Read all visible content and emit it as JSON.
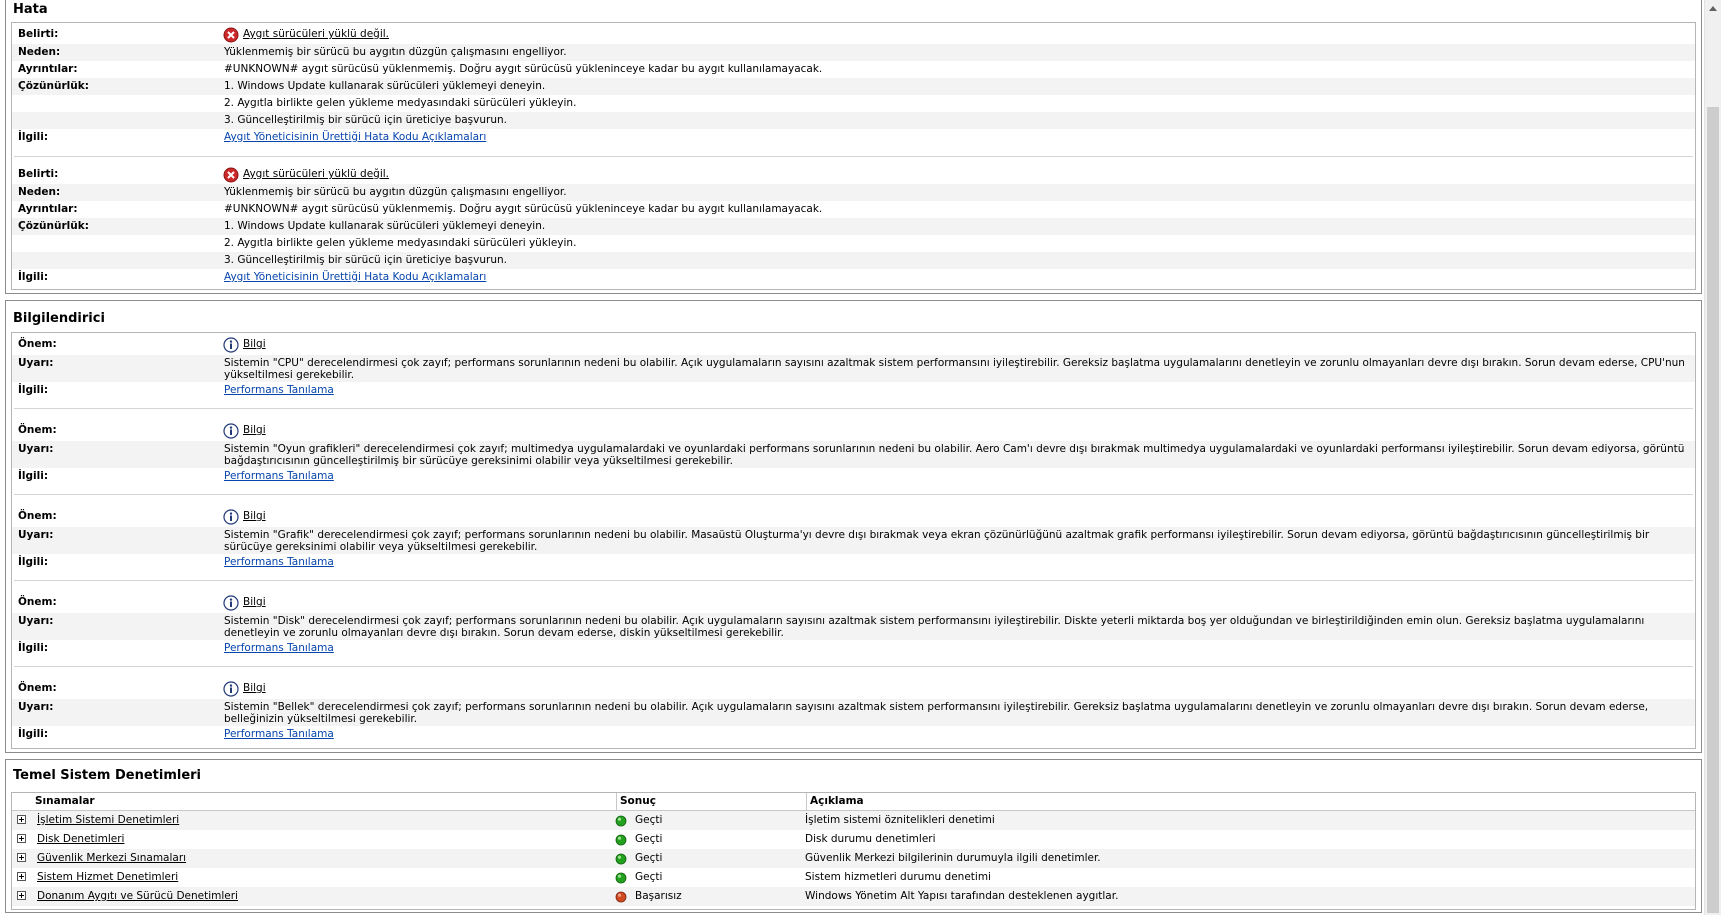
{
  "hata": {
    "title": "Hata",
    "entries": [
      {
        "belirti_label": "Belirti:",
        "belirti": "Aygıt sürücüleri yüklü değil.",
        "neden_label": "Neden:",
        "neden": "Yüklenmemiş bir sürücü bu aygıtın düzgün çalışmasını engelliyor.",
        "ayrintilar_label": "Ayrıntılar:",
        "ayrintilar": "#UNKNOWN# aygıt sürücüsü yüklenmemiş. Doğru aygıt sürücüsü yükleninceye kadar bu aygıt kullanılamayacak.",
        "cozunurluk_label": "Çözünürlük:",
        "cozunurluk": [
          "1. Windows Update kullanarak sürücüleri yüklemeyi deneyin.",
          "2. Aygıtla birlikte gelen yükleme medyasındaki sürücüleri yükleyin.",
          "3. Güncelleştirilmiş bir sürücü için üreticiye başvurun."
        ],
        "ilgili_label": "İlgili:",
        "ilgili": "Aygıt Yöneticisinin Ürettiği Hata Kodu Açıklamaları"
      },
      {
        "belirti_label": "Belirti:",
        "belirti": "Aygıt sürücüleri yüklü değil.",
        "neden_label": "Neden:",
        "neden": "Yüklenmemiş bir sürücü bu aygıtın düzgün çalışmasını engelliyor.",
        "ayrintilar_label": "Ayrıntılar:",
        "ayrintilar": "#UNKNOWN# aygıt sürücüsü yüklenmemiş. Doğru aygıt sürücüsü yükleninceye kadar bu aygıt kullanılamayacak.",
        "cozunurluk_label": "Çözünürlük:",
        "cozunurluk": [
          "1. Windows Update kullanarak sürücüleri yüklemeyi deneyin.",
          "2. Aygıtla birlikte gelen yükleme medyasındaki sürücüleri yükleyin.",
          "3. Güncelleştirilmiş bir sürücü için üreticiye başvurun."
        ],
        "ilgili_label": "İlgili:",
        "ilgili": "Aygıt Yöneticisinin Ürettiği Hata Kodu Açıklamaları"
      }
    ]
  },
  "bilgi": {
    "title": "Bilgilendirici",
    "entries": [
      {
        "onem_label": "Önem:",
        "onem": "Bilgi",
        "uyari_label": "Uyarı:",
        "uyari": "Sistemin \"CPU\" derecelendirmesi çok zayıf; performans sorunlarının nedeni bu olabilir. Açık uygulamaların sayısını azaltmak sistem performansını iyileştirebilir. Gereksiz başlatma uygulamalarını denetleyin ve zorunlu olmayanları devre dışı bırakın. Sorun devam ederse, CPU'nun yükseltilmesi gerekebilir.",
        "ilgili_label": "İlgili:",
        "ilgili": "Performans Tanılama"
      },
      {
        "onem_label": "Önem:",
        "onem": "Bilgi",
        "uyari_label": "Uyarı:",
        "uyari": "Sistemin \"Oyun grafikleri\" derecelendirmesi çok zayıf; multimedya uygulamalardaki ve oyunlardaki performans sorunlarının nedeni bu olabilir. Aero Cam'ı devre dışı bırakmak multimedya uygulamalardaki ve oyunlardaki performansı iyileştirebilir. Sorun devam ediyorsa, görüntü bağdaştırıcısının güncelleştirilmiş bir sürücüye gereksinimi olabilir veya yükseltilmesi gerekebilir.",
        "ilgili_label": "İlgili:",
        "ilgili": "Performans Tanılama"
      },
      {
        "onem_label": "Önem:",
        "onem": "Bilgi",
        "uyari_label": "Uyarı:",
        "uyari": "Sistemin \"Grafik\" derecelendirmesi çok zayıf; performans sorunlarının nedeni bu olabilir. Masaüstü Oluşturma'yı devre dışı bırakmak veya ekran çözünürlüğünü azaltmak grafik performansı iyileştirebilir. Sorun devam ediyorsa, görüntü bağdaştırıcısının güncelleştirilmiş bir sürücüye gereksinimi olabilir veya yükseltilmesi gerekebilir.",
        "ilgili_label": "İlgili:",
        "ilgili": "Performans Tanılama"
      },
      {
        "onem_label": "Önem:",
        "onem": "Bilgi",
        "uyari_label": "Uyarı:",
        "uyari": "Sistemin \"Disk\" derecelendirmesi çok zayıf; performans sorunlarının nedeni bu olabilir. Açık uygulamaların sayısını azaltmak sistem performansını iyileştirebilir. Diskte yeterli miktarda boş yer olduğundan ve birleştirildiğinden emin olun. Gereksiz başlatma uygulamalarını denetleyin ve zorunlu olmayanları devre dışı bırakın. Sorun devam ederse, diskin yükseltilmesi gerekebilir.",
        "ilgili_label": "İlgili:",
        "ilgili": "Performans Tanılama"
      },
      {
        "onem_label": "Önem:",
        "onem": "Bilgi",
        "uyari_label": "Uyarı:",
        "uyari": "Sistemin \"Bellek\" derecelendirmesi çok zayıf; performans sorunlarının nedeni bu olabilir. Açık uygulamaların sayısını azaltmak sistem performansını iyileştirebilir. Gereksiz başlatma uygulamalarını denetleyin ve zorunlu olmayanları devre dışı bırakın. Sorun devam ederse, belleğinizin yükseltilmesi gerekebilir.",
        "ilgili_label": "İlgili:",
        "ilgili": "Performans Tanılama"
      }
    ]
  },
  "temel": {
    "title": "Temel Sistem Denetimleri",
    "headers": [
      "Sınamalar",
      "Sonuç",
      "Açıklama"
    ],
    "rows": [
      {
        "name": "İşletim Sistemi Denetimleri",
        "result": "Geçti",
        "status": "pass",
        "desc": "İşletim sistemi öznitelikleri denetimi"
      },
      {
        "name": "Disk Denetimleri",
        "result": "Geçti",
        "status": "pass",
        "desc": "Disk durumu denetimleri"
      },
      {
        "name": "Güvenlik Merkezi Sınamaları",
        "result": "Geçti",
        "status": "pass",
        "desc": "Güvenlik Merkezi bilgilerinin durumuyla ilgili denetimler."
      },
      {
        "name": "Sistem Hizmet Denetimleri",
        "result": "Geçti",
        "status": "pass",
        "desc": "Sistem hizmetleri durumu denetimi"
      },
      {
        "name": "Donanım Aygıtı ve Sürücü Denetimleri",
        "result": "Başarısız",
        "status": "fail",
        "desc": "Windows Yönetim Alt Yapısı tarafından desteklenen aygıtlar."
      }
    ]
  },
  "colors": {
    "pass": "#22a01e",
    "fail": "#d04a22",
    "error": "#cc2a2a",
    "link": "#0645ad"
  },
  "icons": {
    "error": "error-circle-icon",
    "info": "info-icon",
    "pass": "green-dot-icon",
    "fail": "red-dot-icon",
    "expand": "plus-box-icon"
  }
}
